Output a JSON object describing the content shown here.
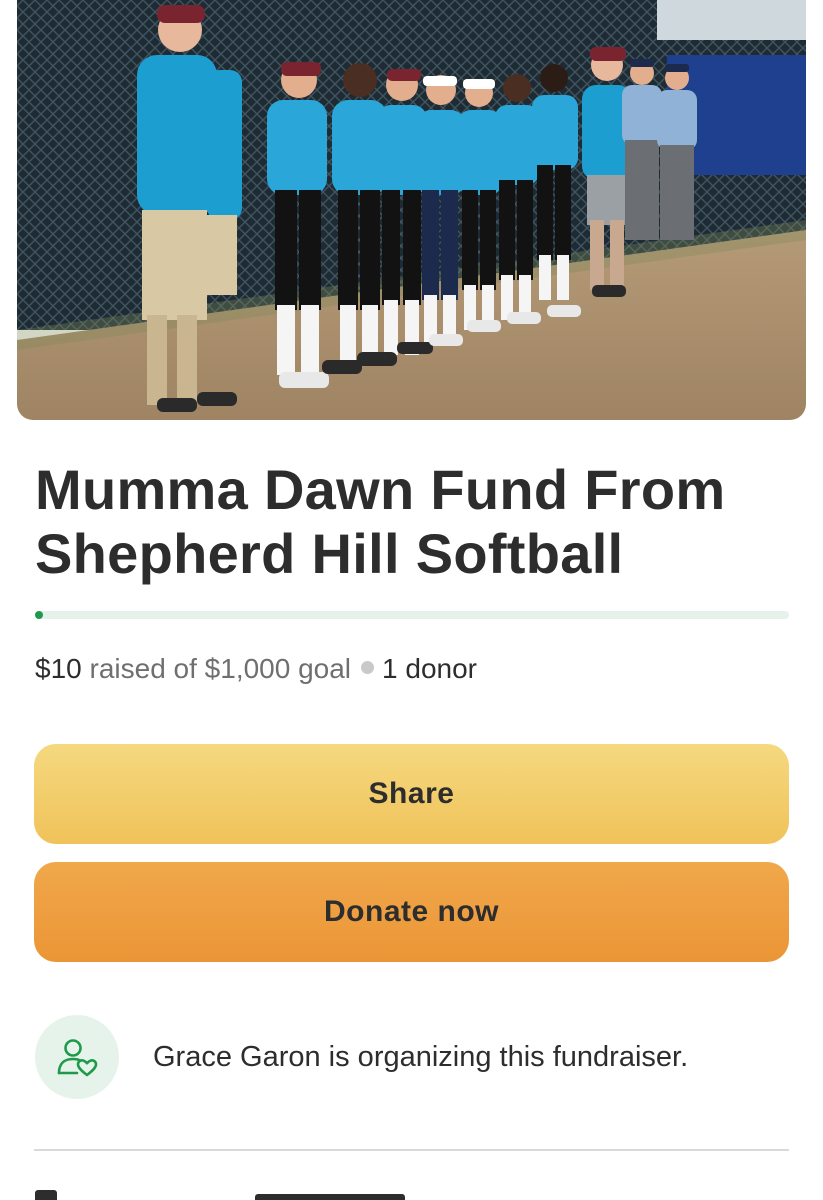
{
  "hero": {
    "image_alt": "Softball team lined up along a fence"
  },
  "fundraiser": {
    "title": "Mumma Dawn Fund From Shepherd Hill Softball",
    "raised": "$10",
    "raised_suffix": "raised of $1,000 goal",
    "donors": "1 donor",
    "progress_fraction": 0.01
  },
  "actions": {
    "share_label": "Share",
    "donate_label": "Donate now"
  },
  "organizer": {
    "text": "Grace Garon is organizing this fundraiser.",
    "icon": "person-heart-icon"
  },
  "colors": {
    "progress": "#1f9a4c",
    "progress_track": "#e4f2ea",
    "share_button": "#f3cf6d",
    "donate_button": "#ee9f41",
    "organizer_icon_bg": "#e6f3ea",
    "organizer_icon": "#1f9a4c"
  }
}
